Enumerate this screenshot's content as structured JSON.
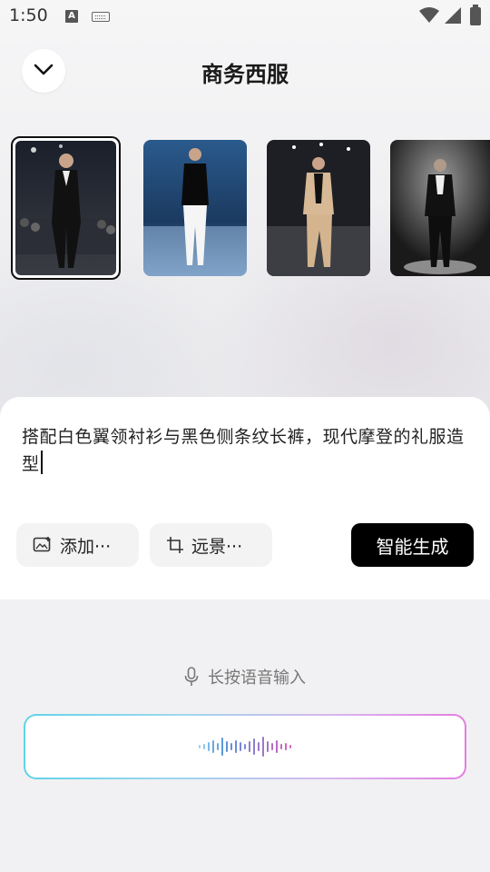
{
  "status_bar": {
    "time": "1:50",
    "input_indicator": "A"
  },
  "header": {
    "title": "商务西服",
    "collapse_icon": "chevron-down-icon"
  },
  "thumbnails": [
    {
      "selected": true,
      "label": ""
    },
    {
      "selected": false,
      "label": ""
    },
    {
      "selected": false,
      "label": ""
    },
    {
      "selected": false,
      "label": ""
    }
  ],
  "prompt": {
    "text": "搭配白色翼领衬衫与黑色侧条纹长裤，现代摩登的礼服造型"
  },
  "chips": {
    "add_label": "添加···",
    "scene_label": "远景···"
  },
  "generate_button": "智能生成",
  "voice": {
    "hint": "长按语音输入"
  },
  "colors": {
    "accent": "#000000",
    "voice_gradient_start": "#5fd3e6",
    "voice_gradient_end": "#e37de0"
  }
}
